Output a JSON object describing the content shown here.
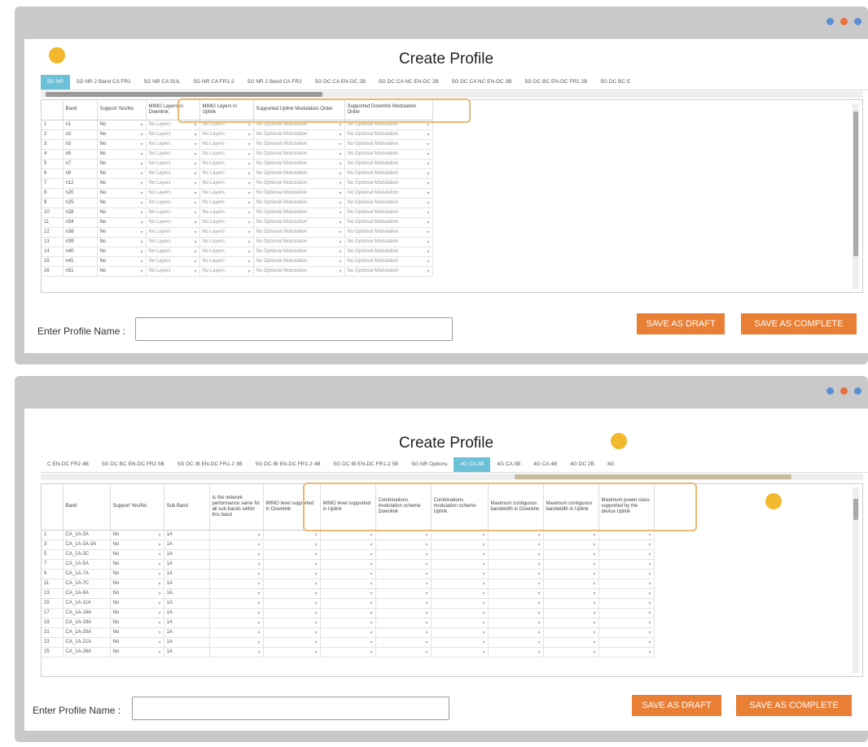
{
  "title": "Create Profile",
  "name_label": "Enter Profile Name :",
  "name_label_2": "Enter Profile Name :",
  "buttons": {
    "draft": "SAVE AS DRAFT",
    "complete": "SAVE AS COMPLETE"
  },
  "colors": {
    "accent": "#e87f35",
    "tab_active": "#6cc0d8",
    "highlight": "#e9b870",
    "marker": "#f2b92e",
    "dot_blue": "#5b8fd4",
    "dot_orange": "#e8703a"
  },
  "screen1": {
    "tabs": [
      "5G NR",
      "5G NR 2 Band CA FR1",
      "5G NR CA SUL",
      "5G NR CA FR1-2",
      "5G NR 2 Band CA FR2",
      "5G DC CA EN-DC 2B",
      "5G DC CA NC EN-DC 2B",
      "5G DC CA NC EN-DC 3B",
      "5G DC BC EN-DC FR1 2B",
      "5G DC BC E"
    ],
    "columns": [
      "",
      "Band",
      "Support Yes/No",
      "MIMO Layers in Downlink",
      "MIMO Layers in Uplink",
      "Supported Uplink Modulation Order",
      "Supported Downlink Modulation Order"
    ],
    "select_placeholder": "No Layers",
    "mod_placeholder": "No Optional Modulation",
    "rows": [
      [
        "1",
        "n1",
        "No"
      ],
      [
        "2",
        "n2",
        "No"
      ],
      [
        "3",
        "n3",
        "No"
      ],
      [
        "4",
        "n5",
        "No"
      ],
      [
        "5",
        "n7",
        "No"
      ],
      [
        "6",
        "n8",
        "No"
      ],
      [
        "7",
        "n12",
        "No"
      ],
      [
        "8",
        "n20",
        "No"
      ],
      [
        "9",
        "n25",
        "No"
      ],
      [
        "10",
        "n28",
        "No"
      ],
      [
        "11",
        "n34",
        "No"
      ],
      [
        "12",
        "n38",
        "No"
      ],
      [
        "13",
        "n39",
        "No"
      ],
      [
        "14",
        "n40",
        "No"
      ],
      [
        "15",
        "n41",
        "No"
      ],
      [
        "16",
        "n51",
        "No"
      ]
    ]
  },
  "screen2": {
    "tabs": [
      "C EN-DC FR2 4B",
      "5G DC BC EN-DC FR2 5B",
      "5G DC IB EN-DC FR1-2 3B",
      "5G DC IB EN-DC FR1-2 4B",
      "5G DC IB EN-DC FR1-2 5B",
      "5G NR Options",
      "4G CA 3B",
      "4G CA 3B",
      "4G CA 4B",
      "4G DC 2B",
      "4G"
    ],
    "columns": [
      "",
      "Band",
      "Support Yes/No",
      "Sub Band",
      "Is the network performance same for all sub bands within this band",
      "MIMO level supported in Downlink",
      "MIMO level supported in Uplink",
      "Combinations modulation scheme Downlink",
      "Combinations modulation scheme Uplink",
      "Maximum contiguous bandwidth in Downlink",
      "Maximum contiguous bandwidth in Uplink",
      "Maximum power class supported by the device Uplink"
    ],
    "rows": [
      [
        "1",
        "CA_1A-3A",
        "No",
        "1A"
      ],
      [
        "3",
        "CA_1A-3A-3A",
        "No",
        "1A"
      ],
      [
        "5",
        "CA_1A-3C",
        "No",
        "1A"
      ],
      [
        "7",
        "CA_1A-5A",
        "No",
        "1A"
      ],
      [
        "9",
        "CA_1A-7A",
        "No",
        "1A"
      ],
      [
        "11",
        "CA_1A-7C",
        "No",
        "1A"
      ],
      [
        "13",
        "CA_1A-8A",
        "No",
        "1A"
      ],
      [
        "15",
        "CA_1A-11A",
        "No",
        "1A"
      ],
      [
        "17",
        "CA_1A-18A",
        "No",
        "1A"
      ],
      [
        "19",
        "CA_1A-19A",
        "No",
        "1A"
      ],
      [
        "21",
        "CA_1A-20A",
        "No",
        "1A"
      ],
      [
        "23",
        "CA_1A-21A",
        "No",
        "1A"
      ],
      [
        "25",
        "CA_1A-26A",
        "No",
        "1A"
      ]
    ]
  }
}
